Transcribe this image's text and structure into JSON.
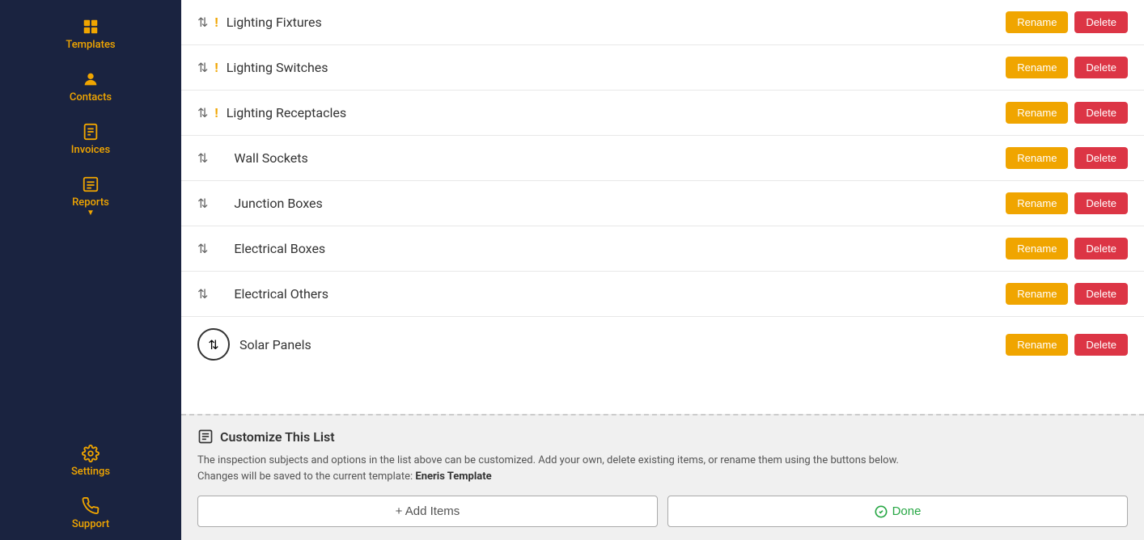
{
  "sidebar": {
    "items": [
      {
        "id": "templates",
        "label": "Templates",
        "icon": "template-icon"
      },
      {
        "id": "contacts",
        "label": "Contacts",
        "icon": "contacts-icon"
      },
      {
        "id": "invoices",
        "label": "Invoices",
        "icon": "invoices-icon"
      },
      {
        "id": "reports",
        "label": "Reports",
        "icon": "reports-icon"
      },
      {
        "id": "settings",
        "label": "Settings",
        "icon": "settings-icon"
      },
      {
        "id": "support",
        "label": "Support",
        "icon": "support-icon"
      }
    ],
    "accent_color": "#f0a500"
  },
  "list": {
    "items": [
      {
        "id": 1,
        "name": "Lighting Fixtures",
        "has_warning": true
      },
      {
        "id": 2,
        "name": "Lighting Switches",
        "has_warning": true
      },
      {
        "id": 3,
        "name": "Lighting Receptacles",
        "has_warning": true
      },
      {
        "id": 4,
        "name": "Wall Sockets",
        "has_warning": false
      },
      {
        "id": 5,
        "name": "Junction Boxes",
        "has_warning": false
      },
      {
        "id": 6,
        "name": "Electrical Boxes",
        "has_warning": false
      },
      {
        "id": 7,
        "name": "Electrical Others",
        "has_warning": false
      },
      {
        "id": 8,
        "name": "Solar Panels",
        "has_warning": false
      }
    ],
    "rename_label": "Rename",
    "delete_label": "Delete"
  },
  "customize": {
    "title": "Customize This List",
    "description": "The inspection subjects and options in the list above can be customized. Add your own, delete existing items, or rename them using the buttons below.",
    "description2": "Changes will be saved to the current template:",
    "template_name": "Eneris Template",
    "add_items_label": "+ Add Items",
    "done_label": "Done"
  }
}
